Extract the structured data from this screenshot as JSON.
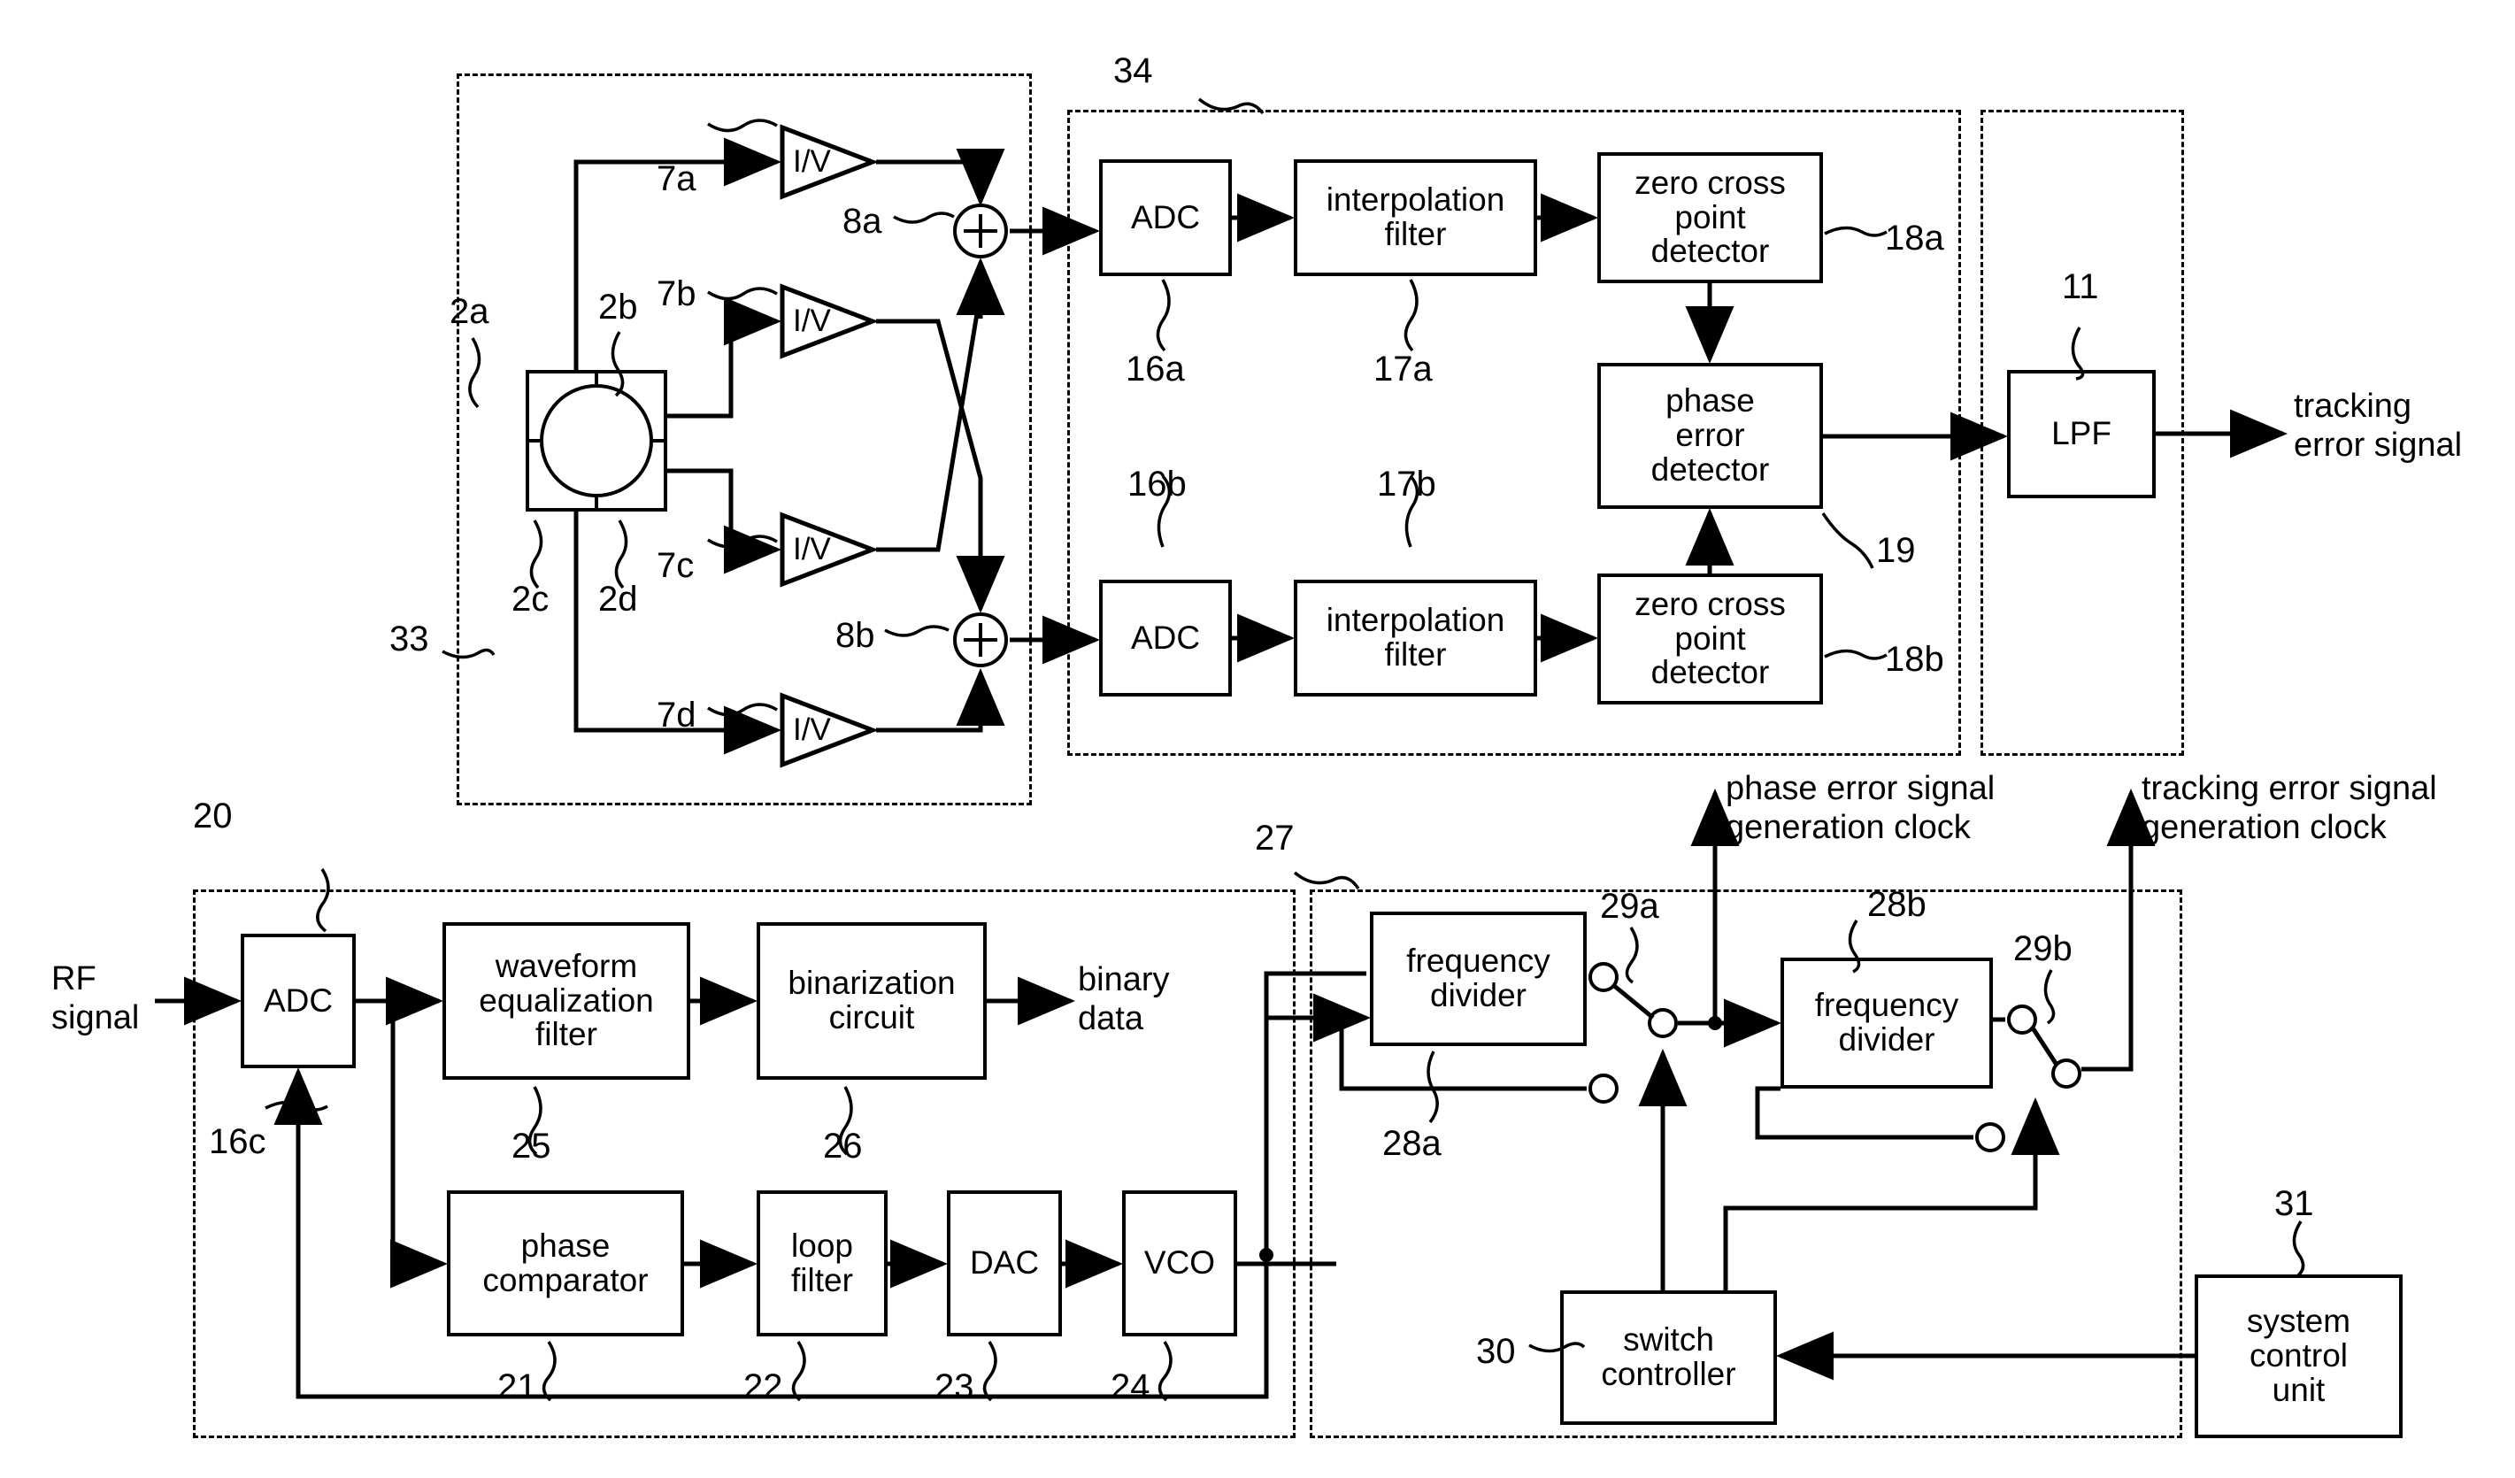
{
  "diagram": {
    "title": "Optical disc tracking error / clock generation block diagram",
    "blocks": {
      "iv_a": "I/V",
      "iv_b": "I/V",
      "iv_c": "I/V",
      "iv_d": "I/V",
      "adc_a": "ADC",
      "adc_b": "ADC",
      "adc_c": "ADC",
      "interp_a": "interpolation\nfilter",
      "interp_b": "interpolation\nfilter",
      "zero_a": "zero cross\npoint\ndetector",
      "zero_b": "zero cross\npoint\ndetector",
      "phase_error": "phase\nerror\ndetector",
      "lpf": "LPF",
      "wave_eq": "waveform\nequalization\nfilter",
      "binarization": "binarization\ncircuit",
      "phase_comparator": "phase\ncomparator",
      "loop_filter": "loop\nfilter",
      "dac": "DAC",
      "vco": "VCO",
      "freq_div_a": "frequency\ndivider",
      "freq_div_b": "frequency\ndivider",
      "switch_controller": "switch\ncontroller",
      "system_control": "system\ncontrol\nunit"
    },
    "signals": {
      "rf_signal": "RF\nsignal",
      "tracking_error_signal": "tracking\nerror signal",
      "binary_data": "binary\ndata",
      "phase_error_clock": "phase error signal\ngeneration clock",
      "tracking_error_clock": "tracking error signal\ngeneration clock"
    },
    "refs": {
      "r2a": "2a",
      "r2b": "2b",
      "r2c": "2c",
      "r2d": "2d",
      "r7a": "7a",
      "r7b": "7b",
      "r7c": "7c",
      "r7d": "7d",
      "r8a": "8a",
      "r8b": "8b",
      "r11": "11",
      "r16a": "16a",
      "r16b": "16b",
      "r16c": "16c",
      "r17a": "17a",
      "r17b": "17b",
      "r18a": "18a",
      "r18b": "18b",
      "r19": "19",
      "r20": "20",
      "r21": "21",
      "r22": "22",
      "r23": "23",
      "r24": "24",
      "r25": "25",
      "r26": "26",
      "r27": "27",
      "r28a": "28a",
      "r28b": "28b",
      "r29a": "29a",
      "r29b": "29b",
      "r30": "30",
      "r31": "31",
      "r33": "33",
      "r34": "34"
    }
  }
}
